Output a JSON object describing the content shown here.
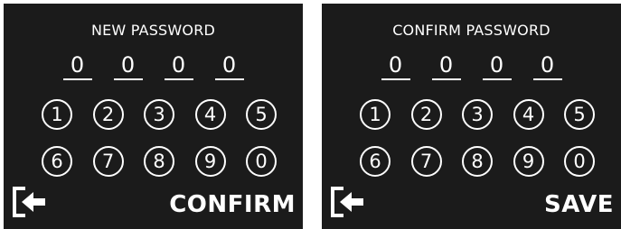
{
  "theme": {
    "panel_background": "#1b1b1b",
    "text_color": "#ffffff",
    "page_background": "#ffffff"
  },
  "panels": [
    {
      "title": "NEW PASSWORD",
      "digits": [
        "0",
        "0",
        "0",
        "0"
      ],
      "keypad_row1": [
        "1",
        "2",
        "3",
        "4",
        "5"
      ],
      "keypad_row2": [
        "6",
        "7",
        "8",
        "9",
        "0"
      ],
      "back_icon": "sign-out-arrow-icon",
      "action_label": "CONFIRM"
    },
    {
      "title": "CONFIRM PASSWORD",
      "digits": [
        "0",
        "0",
        "0",
        "0"
      ],
      "keypad_row1": [
        "1",
        "2",
        "3",
        "4",
        "5"
      ],
      "keypad_row2": [
        "6",
        "7",
        "8",
        "9",
        "0"
      ],
      "back_icon": "sign-out-arrow-icon",
      "action_label": "SAVE"
    }
  ]
}
